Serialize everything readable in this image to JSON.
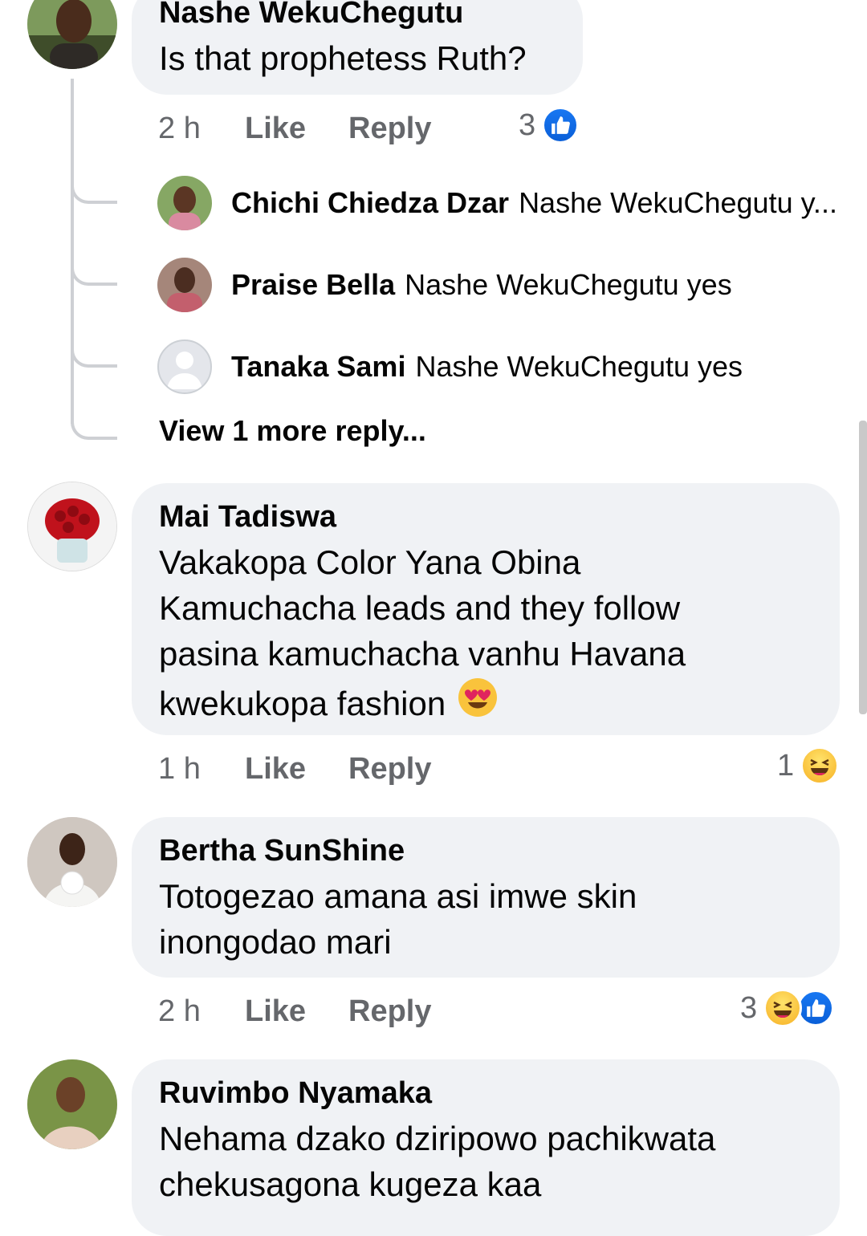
{
  "comments": [
    {
      "author": "Nashe WekuChegutu",
      "text": [
        "Is that prophetess Ruth?"
      ],
      "time": "2 h",
      "like_label": "Like",
      "reply_label": "Reply",
      "reaction_count": "3",
      "reactions": [
        "like-icon"
      ]
    },
    {
      "author": "Mai Tadiswa",
      "text": [
        "Vakakopa Color Yana Obina",
        "Kamuchacha leads and they follow",
        "pasina kamuchacha vanhu Havana",
        "kwekukopa fashion"
      ],
      "emoji": "heart-eyes-emoji",
      "time": "1 h",
      "like_label": "Like",
      "reply_label": "Reply",
      "reaction_count": "1",
      "reactions": [
        "haha-icon"
      ]
    },
    {
      "author": "Bertha SunShine",
      "text": [
        "Totogezao amana asi imwe skin",
        "inongodao mari"
      ],
      "time": "2 h",
      "like_label": "Like",
      "reply_label": "Reply",
      "reaction_count": "3",
      "reactions": [
        "haha-icon",
        "like-icon"
      ]
    },
    {
      "author": "Ruvimbo Nyamaka",
      "text": [
        "Nehama dzako dziripowo pachikwata",
        "chekusagona kugeza kaa"
      ]
    }
  ],
  "replies": [
    {
      "author": "Chichi Chiedza Dzar",
      "text": "Nashe WekuChegutu y..."
    },
    {
      "author": "Praise Bella",
      "text": "Nashe WekuChegutu yes"
    },
    {
      "author": "Tanaka Sami",
      "text": "Nashe WekuChegutu yes"
    }
  ],
  "view_more_label": "View 1 more reply..."
}
